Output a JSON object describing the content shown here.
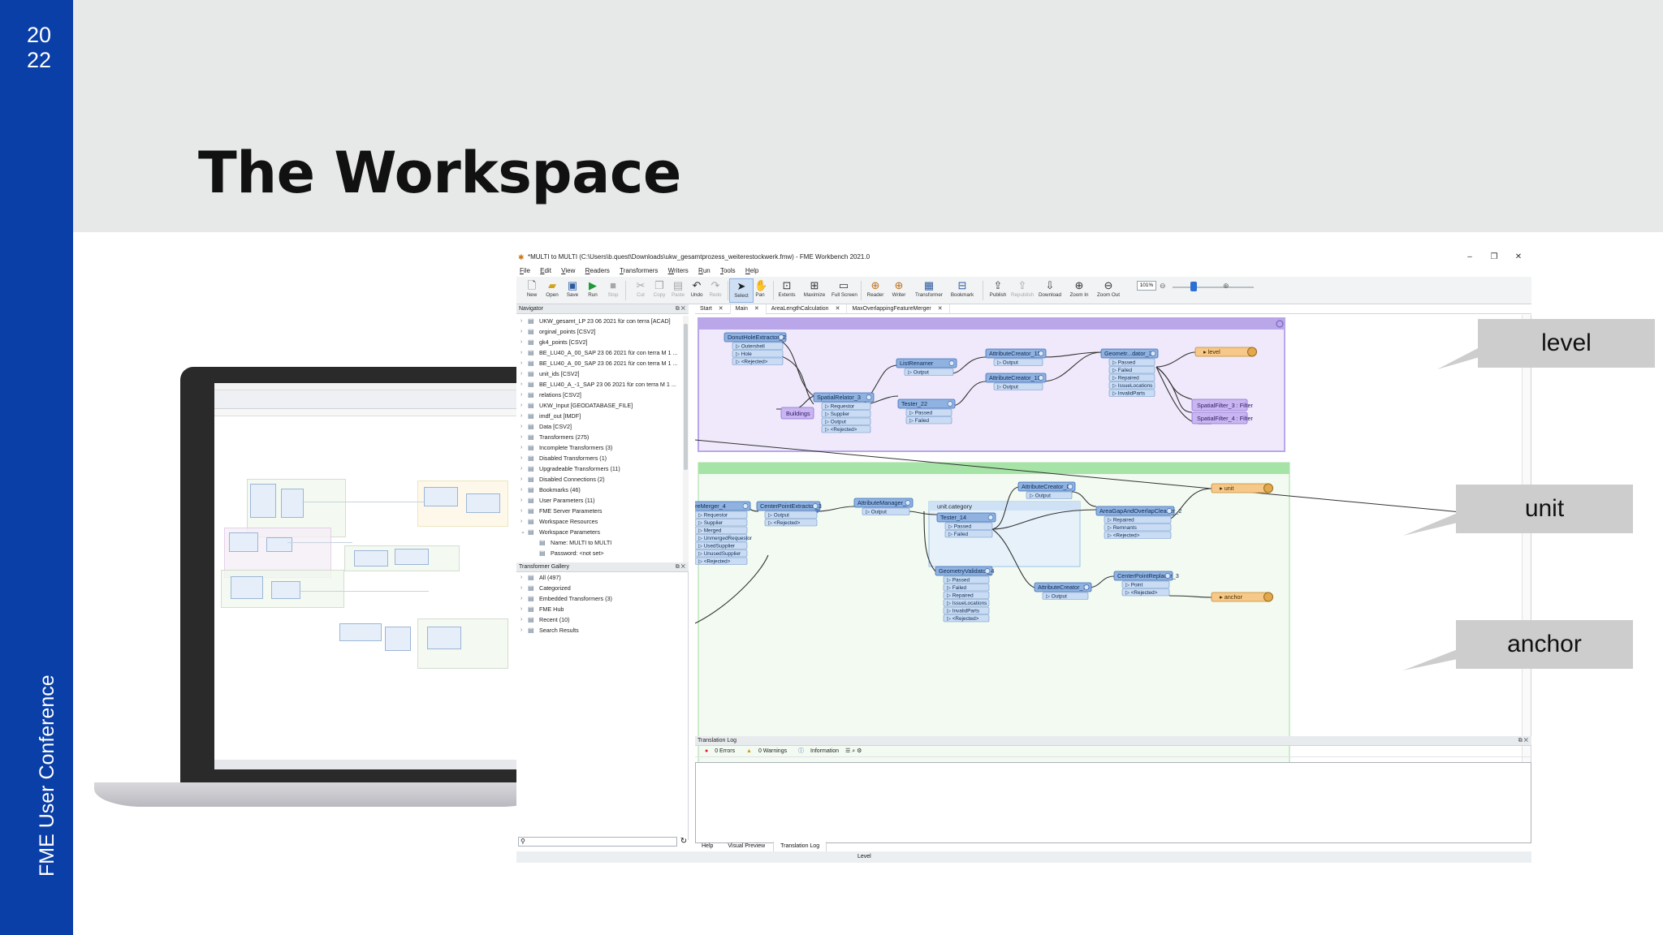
{
  "slide": {
    "year_line1": "20",
    "year_line2": "22",
    "title": "The Workspace",
    "vertical_label": "FME User Conference",
    "colors": {
      "sidebar": "#0a3fa8",
      "header": "#e7e9e8"
    }
  },
  "window": {
    "title": "*MULTI to MULTI (C:\\Users\\b.quest\\Downloads\\ukw_gesamtprozess_weiterestockwerk.fmw) - FME Workbench 2021.0",
    "menu": [
      "File",
      "Edit",
      "View",
      "Readers",
      "Transformers",
      "Writers",
      "Run",
      "Tools",
      "Help"
    ],
    "toolbar": [
      {
        "label": "New",
        "icon": "new-icon",
        "enabled": true
      },
      {
        "label": "Open",
        "icon": "open-icon",
        "enabled": true
      },
      {
        "label": "Save",
        "icon": "save-icon",
        "enabled": true
      },
      {
        "label": "Run",
        "icon": "run-icon",
        "enabled": true
      },
      {
        "label": "Stop",
        "icon": "stop-icon",
        "enabled": false
      },
      {
        "label": "Cut",
        "icon": "cut-icon",
        "enabled": false
      },
      {
        "label": "Copy",
        "icon": "copy-icon",
        "enabled": false
      },
      {
        "label": "Paste",
        "icon": "paste-icon",
        "enabled": false
      },
      {
        "label": "Undo",
        "icon": "undo-icon",
        "enabled": true
      },
      {
        "label": "Redo",
        "icon": "redo-icon",
        "enabled": false
      },
      {
        "label": "Select",
        "icon": "select-icon",
        "enabled": true
      },
      {
        "label": "Pan",
        "icon": "pan-icon",
        "enabled": true
      },
      {
        "label": "Extents",
        "icon": "extents-icon",
        "enabled": true
      },
      {
        "label": "Maximize",
        "icon": "maximize-icon",
        "enabled": true
      },
      {
        "label": "Full Screen",
        "icon": "fullscreen-icon",
        "enabled": true
      },
      {
        "label": "Reader",
        "icon": "reader-icon",
        "enabled": true
      },
      {
        "label": "Writer",
        "icon": "writer-icon",
        "enabled": true
      },
      {
        "label": "Transformer",
        "icon": "transformer-icon",
        "enabled": true
      },
      {
        "label": "Bookmark",
        "icon": "bookmark-icon",
        "enabled": true
      },
      {
        "label": "Publish",
        "icon": "publish-icon",
        "enabled": true
      },
      {
        "label": "Republish",
        "icon": "republish-icon",
        "enabled": false
      },
      {
        "label": "Download",
        "icon": "download-icon",
        "enabled": true
      },
      {
        "label": "Zoom In",
        "icon": "zoom-in-icon",
        "enabled": true
      },
      {
        "label": "Zoom Out",
        "icon": "zoom-out-icon",
        "enabled": true
      }
    ],
    "zoom_level": "101%",
    "tabs": [
      {
        "label": "Start",
        "active": false
      },
      {
        "label": "Main",
        "active": true
      },
      {
        "label": "AreaLengthCalculation",
        "active": false
      },
      {
        "label": "MaxOverlappingFeatureMerger",
        "active": false
      }
    ],
    "navigator": {
      "header": "Navigator",
      "items": [
        {
          "label": "UKW_gesamt_LP 23 06 2021 für con terra [ACAD]",
          "child": false
        },
        {
          "label": "orginal_points [CSV2]",
          "child": false
        },
        {
          "label": "gk4_points [CSV2]",
          "child": false
        },
        {
          "label": "BE_LU40_A_00_SAP 23 06 2021 für con terra M 1 ...",
          "child": false
        },
        {
          "label": "BE_LU40_A_00_SAP 23 06 2021 für con terra M 1 ...",
          "child": false
        },
        {
          "label": "unit_ids [CSV2]",
          "child": false
        },
        {
          "label": "BE_LU40_A_-1_SAP 23 06 2021 für con terra M 1 ...",
          "child": false
        },
        {
          "label": "relations [CSV2]",
          "child": false
        },
        {
          "label": "UKW_Input [GEODATABASE_FILE]",
          "child": false
        },
        {
          "label": "imdf_out [IMDF]",
          "child": false
        },
        {
          "label": "Data [CSV2]",
          "child": false
        },
        {
          "label": "Transformers (275)",
          "child": false
        },
        {
          "label": "Incomplete Transformers (3)",
          "child": false
        },
        {
          "label": "Disabled Transformers (1)",
          "child": false
        },
        {
          "label": "Upgradeable Transformers (11)",
          "child": false
        },
        {
          "label": "Disabled Connections (2)",
          "child": false
        },
        {
          "label": "Bookmarks (46)",
          "child": false
        },
        {
          "label": "User Parameters (11)",
          "child": false
        },
        {
          "label": "FME Server Parameters",
          "child": false
        },
        {
          "label": "Workspace Resources",
          "child": false
        },
        {
          "label": "Workspace Parameters",
          "child": false
        },
        {
          "label": "Name: MULTI to MULTI",
          "child": true
        },
        {
          "label": "Password: <not set>",
          "child": true
        }
      ]
    },
    "gallery": {
      "header": "Transformer Gallery",
      "items": [
        "All (497)",
        "Categorized",
        "Embedded Transformers (3)",
        "FME Hub",
        "Recent (10)",
        "Search Results"
      ]
    },
    "translation_log": {
      "header": "Translation Log",
      "errors": "0 Errors",
      "warnings": "0 Warnings",
      "information": "Information"
    },
    "bottom_tabs": [
      "Help",
      "Visual Preview",
      "Translation Log"
    ],
    "status": "Level"
  },
  "canvas": {
    "top_group": {
      "donut": {
        "title": "DonutHoleExtractor_2",
        "ports": [
          "Outershell",
          "Hole",
          "<Rejected>"
        ]
      },
      "buildings": "Buildings",
      "spatial": {
        "title": "SpatialRelator_3",
        "ports": [
          "Requestor",
          "Supplier",
          "Output",
          "<Rejected>"
        ]
      },
      "list_renamer": {
        "title": "ListRenamer",
        "ports": [
          "Output"
        ]
      },
      "tester22": {
        "title": "Tester_22",
        "ports": [
          "Passed",
          "Failed"
        ]
      },
      "ac15": {
        "title": "AttributeCreator_15",
        "ports": [
          "Output"
        ]
      },
      "ac18": {
        "title": "AttributeCreator_18",
        "ports": [
          "Output"
        ]
      },
      "geomval3": {
        "title": "Geometr...dator_3",
        "ports": [
          "Passed",
          "Failed",
          "Repaired",
          "IssueLocations",
          "InvalidParts"
        ]
      },
      "writer": "level",
      "sf3": "SpatialFilter_3 : Filter",
      "sf4": "SpatialFilter_4 : Filter"
    },
    "bottom_group": {
      "merger": {
        "title": "tureMerger_4",
        "ports": [
          "Requestor",
          "Supplier",
          "Merged",
          "UnmergedRequestor",
          "UsedSupplier",
          "UnusedSupplier",
          "<Rejected>"
        ]
      },
      "cpe3": {
        "title": "CenterPointExtractor_3",
        "ports": [
          "Output",
          "<Rejected>"
        ]
      },
      "am2": {
        "title": "AttributeManager_2",
        "ports": [
          "Output"
        ]
      },
      "category": "unit.category",
      "tester14": {
        "title": "Tester_14",
        "ports": [
          "Passed",
          "Failed"
        ]
      },
      "ac8": {
        "title": "AttributeCreator_8",
        "ports": [
          "Output"
        ]
      },
      "agoc2": {
        "title": "AreaGapAndOverlapCleaner_2",
        "ports": [
          "Repaired",
          "Remnants",
          "<Rejected>"
        ]
      },
      "unit_writer": "unit",
      "gv4": {
        "title": "GeometryValidator_4",
        "ports": [
          "Passed",
          "Failed",
          "Repaired",
          "IssueLocations",
          "InvalidParts",
          "<Rejected>"
        ]
      },
      "ac16": {
        "title": "AttributeCreator_16",
        "ports": [
          "Output"
        ]
      },
      "cpr3": {
        "title": "CenterPointReplacer_3",
        "ports": [
          "Point",
          "<Rejected>"
        ]
      },
      "anchor_writer": "anchor"
    }
  },
  "callouts": [
    "level",
    "unit",
    "anchor"
  ]
}
